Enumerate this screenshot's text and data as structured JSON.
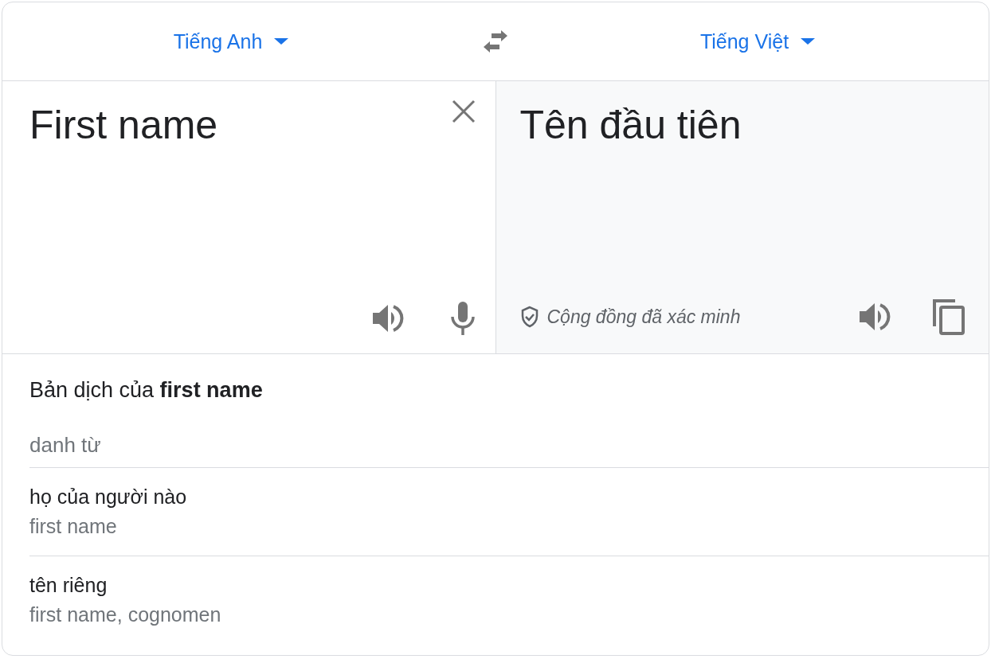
{
  "languages": {
    "source": {
      "label": "Tiếng Anh"
    },
    "target": {
      "label": "Tiếng Việt"
    }
  },
  "source": {
    "text": "First name"
  },
  "target": {
    "text": "Tên đầu tiên",
    "verified_label": "Cộng đồng đã xác minh"
  },
  "dictionary": {
    "heading": "Bản dịch của **first name**",
    "groups": [
      {
        "part_of_speech": "danh từ",
        "entries": [
          {
            "term": "họ của người nào",
            "synonyms": "first name"
          },
          {
            "term": "tên riêng",
            "synonyms": "first name, cognomen"
          }
        ]
      }
    ]
  }
}
